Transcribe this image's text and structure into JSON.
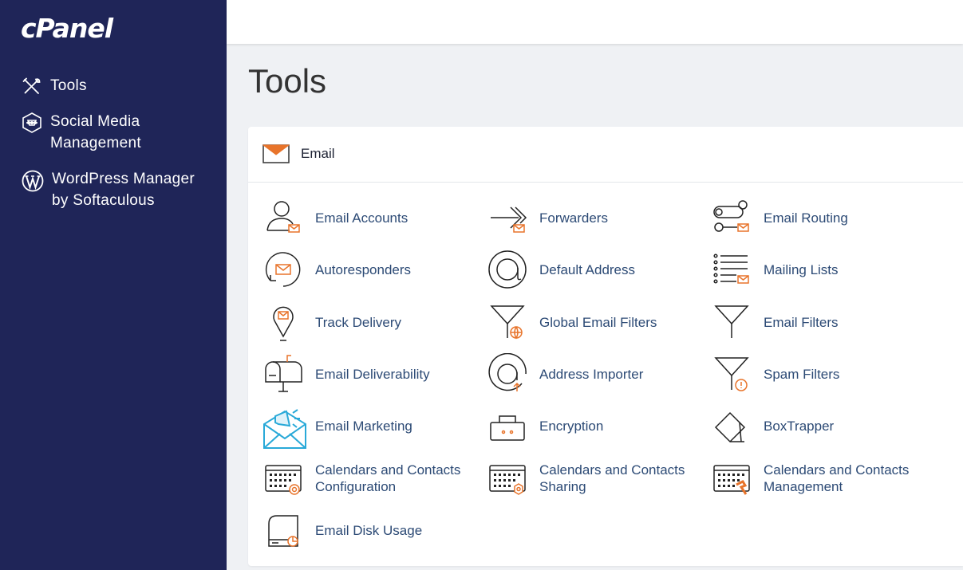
{
  "brand": {
    "logo_text": "cPanel"
  },
  "sidebar": {
    "items": [
      {
        "label": "Tools",
        "icon": "tools-icon"
      },
      {
        "label": "Social Media Management",
        "icon": "social-media-icon"
      },
      {
        "label": "WordPress Manager by Softaculous",
        "icon": "wordpress-icon"
      }
    ]
  },
  "page": {
    "title": "Tools"
  },
  "email_section": {
    "title": "Email",
    "icon": "envelope-icon",
    "tools": [
      {
        "label": "Email Accounts",
        "icon": "user-mail-icon"
      },
      {
        "label": "Forwarders",
        "icon": "forward-arrow-icon"
      },
      {
        "label": "Email Routing",
        "icon": "routing-icon"
      },
      {
        "label": "Autoresponders",
        "icon": "autoresponder-icon"
      },
      {
        "label": "Default Address",
        "icon": "at-sign-icon"
      },
      {
        "label": "Mailing Lists",
        "icon": "list-mail-icon"
      },
      {
        "label": "Track Delivery",
        "icon": "location-pin-icon"
      },
      {
        "label": "Global Email Filters",
        "icon": "filter-globe-icon"
      },
      {
        "label": "Email Filters",
        "icon": "filter-icon"
      },
      {
        "label": "Email Deliverability",
        "icon": "mailbox-icon"
      },
      {
        "label": "Address Importer",
        "icon": "at-import-icon"
      },
      {
        "label": "Spam Filters",
        "icon": "filter-warning-icon"
      },
      {
        "label": "Email Marketing",
        "icon": "megaphone-envelope-icon"
      },
      {
        "label": "Encryption",
        "icon": "lock-icon"
      },
      {
        "label": "BoxTrapper",
        "icon": "box-trap-icon"
      },
      {
        "label_line1": "Calendars and Contacts",
        "label_line2": "Configuration",
        "icon": "calendar-at-icon"
      },
      {
        "label_line1": "Calendars and Contacts",
        "label_line2": "Sharing",
        "icon": "calendar-gear-icon"
      },
      {
        "label_line1": "Calendars and Contacts",
        "label_line2": "Management",
        "icon": "calendar-hammer-icon"
      },
      {
        "label": "Email Disk Usage",
        "icon": "disk-usage-icon"
      }
    ]
  },
  "colors": {
    "sidebar_bg": "#1f2558",
    "link": "#2c4a75",
    "accent": "#e8742b",
    "marketing": "#29a9d8"
  }
}
